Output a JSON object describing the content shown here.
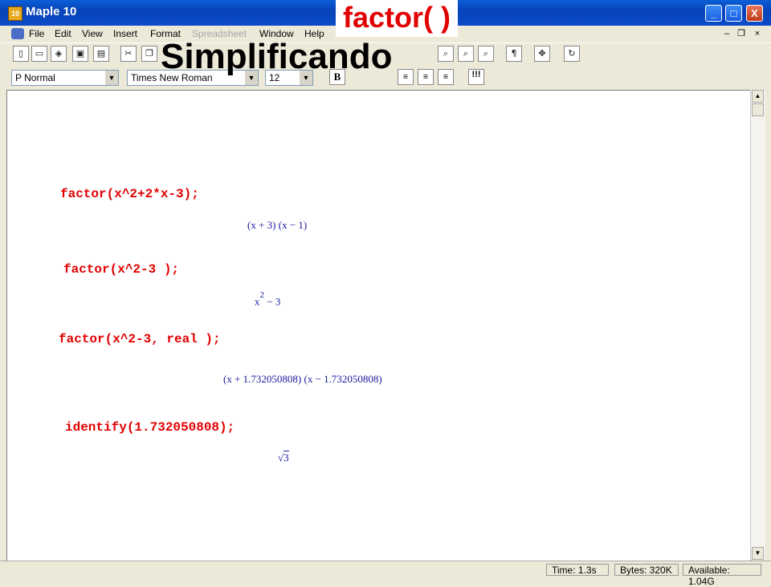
{
  "window": {
    "title": "Maple 10",
    "app_icon": "maple-10-icon",
    "controls": {
      "minimize": "_",
      "maximize": "□",
      "close": "X"
    }
  },
  "menu": {
    "items": [
      "File",
      "Edit",
      "View",
      "Insert",
      "Format",
      "Spreadsheet",
      "Window",
      "Help"
    ],
    "disabled": [
      "Spreadsheet"
    ],
    "mdi": {
      "minimize": "–",
      "restore": "❐",
      "close": "×"
    }
  },
  "format_bar": {
    "style": "P Normal",
    "font": "Times New Roman",
    "size": "12",
    "bold": "B",
    "exec_all": "!!!"
  },
  "toolbar_icons": [
    "new-icon",
    "open-icon",
    "open-url-icon",
    "save-icon",
    "print-icon",
    "cut-icon",
    "copy-icon",
    "zoom-in-icon",
    "zoom-out-icon",
    "zoom-fit-icon",
    "paragraph-icon",
    "move-icon",
    "restart-icon"
  ],
  "overlay": {
    "title": "factor( )",
    "subtitle": "Simplificando"
  },
  "worksheet": {
    "cmd1": "factor(x^2+2*x-3);",
    "out1": "(x + 3) (x − 1)",
    "cmd2": "factor(x^2-3 );",
    "out2_base": "x",
    "out2_exp": "2",
    "out2_rest": " − 3",
    "cmd3": "factor(x^2-3, real );",
    "out3": "(x + 1.732050808) (x − 1.732050808)",
    "cmd4": "identify(1.732050808);",
    "out4_radical": "√",
    "out4_radicand": "3"
  },
  "status": {
    "time": "Time:   1.3s",
    "bytes": "Bytes:  320K",
    "available": "Available:  1.04G"
  }
}
